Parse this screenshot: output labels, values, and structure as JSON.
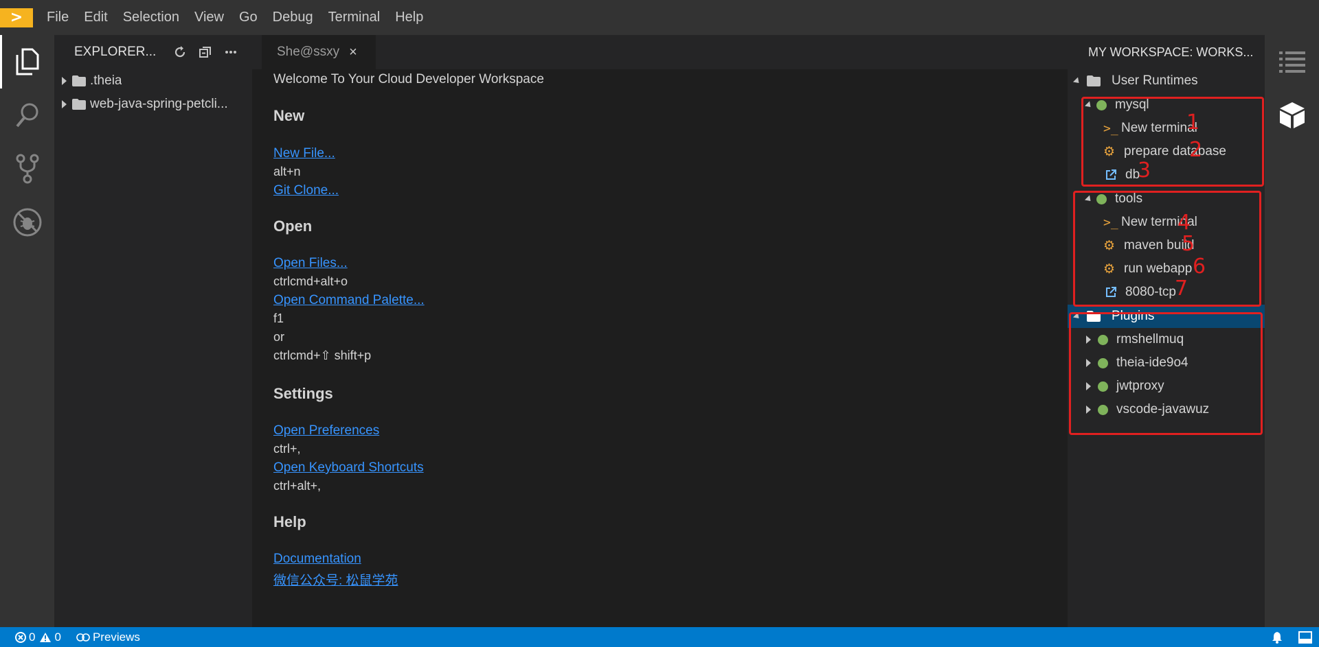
{
  "menu": [
    "File",
    "Edit",
    "Selection",
    "View",
    "Go",
    "Debug",
    "Terminal",
    "Help"
  ],
  "explorer": {
    "title": "EXPLORER...",
    "items": [
      ".theia",
      "web-java-spring-petcli..."
    ]
  },
  "tab": {
    "label": "She@ssxy",
    "close": "×"
  },
  "welcome": {
    "title": "Welcome To Your Cloud Developer Workspace",
    "new_heading": "New",
    "new_file": "New File...",
    "new_file_key": "alt+n",
    "git_clone": "Git Clone...",
    "open_heading": "Open",
    "open_files": "Open Files...",
    "open_files_key": "ctrlcmd+alt+o",
    "open_palette": "Open Command Palette...",
    "palette_key1": "f1",
    "palette_or": "or",
    "palette_key2": "ctrlcmd+⇧ shift+p",
    "settings_heading": "Settings",
    "open_prefs": "Open Preferences",
    "prefs_key": "ctrl+,",
    "open_shortcuts": "Open Keyboard Shortcuts",
    "shortcuts_key": "ctrl+alt+,",
    "help_heading": "Help",
    "docs": "Documentation",
    "wechat": "微信公众号: 松鼠学苑"
  },
  "workspace": {
    "title": "MY WORKSPACE: WORKS...",
    "user_runtimes": "User Runtimes",
    "mysql": "mysql",
    "mysql_cmds": [
      "New terminal",
      "prepare database",
      "db"
    ],
    "tools": "tools",
    "tools_cmds": [
      "New terminal",
      "maven build",
      "run webapp",
      "8080-tcp"
    ],
    "plugins": "Plugins",
    "plugin_items": [
      "rmshellmuq",
      "theia-ide9o4",
      "jwtproxy",
      "vscode-javawuz"
    ],
    "annotations": [
      "1",
      "2",
      "3",
      "4",
      "5",
      "6",
      "7"
    ]
  },
  "statusbar": {
    "errors": "0",
    "warnings": "0",
    "previews": "Previews"
  },
  "colors": {
    "accent": "#007acc",
    "logo": "#f6b31f",
    "runtime_dot": "#7fb35b",
    "annotation": "#e02020",
    "link": "#3794ff"
  }
}
